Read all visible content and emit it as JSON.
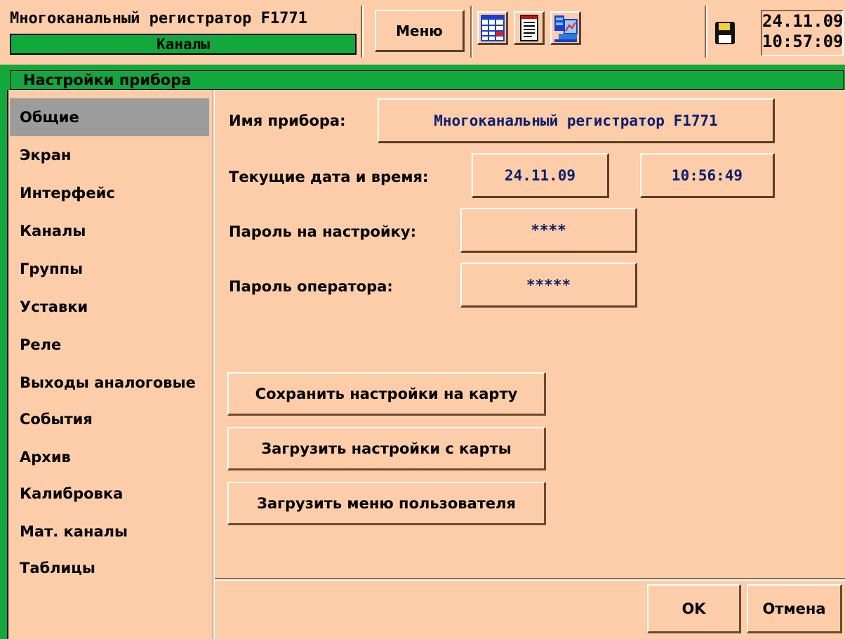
{
  "header": {
    "app_title": "Многоканальный регистратор F1771",
    "active_section": "Каналы",
    "menu_label": "Меню",
    "toolbar_icons": [
      "table-icon",
      "notepad-icon",
      "chart-computer-icon"
    ],
    "storage_icon": "floppy-disk-icon",
    "date": "24.11.09",
    "time": "10:57:09"
  },
  "window": {
    "title": "Настройки прибора"
  },
  "sidebar": {
    "items": [
      {
        "label": "Общие",
        "active": true
      },
      {
        "label": "Экран"
      },
      {
        "label": "Интерфейс"
      },
      {
        "label": "Каналы"
      },
      {
        "label": "Группы"
      },
      {
        "label": "Уставки"
      },
      {
        "label": "Реле"
      },
      {
        "label": "Выходы аналоговые"
      },
      {
        "label": "События"
      },
      {
        "label": "Архив"
      },
      {
        "label": "Калибровка"
      },
      {
        "label": "Мат. каналы"
      },
      {
        "label": "Таблицы"
      }
    ]
  },
  "form": {
    "device_name_label": "Имя прибора:",
    "device_name_value": "Многоканальный регистратор F1771",
    "datetime_label": "Текущие дата и время:",
    "date_value": "24.11.09",
    "time_value": "10:56:49",
    "setup_password_label": "Пароль на настройку:",
    "setup_password_value": "****",
    "operator_password_label": "Пароль оператора:",
    "operator_password_value": "*****"
  },
  "actions": {
    "save_to_card": "Сохранить настройки на карту",
    "load_from_card": "Загрузить настройки с карты",
    "load_user_menu": "Загрузить меню пользователя",
    "ok": "OK",
    "cancel": "Отмена"
  },
  "colors": {
    "background": "#fdcda9",
    "accent_green": "#13a83c",
    "active_item": "#9c9c9c",
    "value_text": "#0b1e6e"
  }
}
